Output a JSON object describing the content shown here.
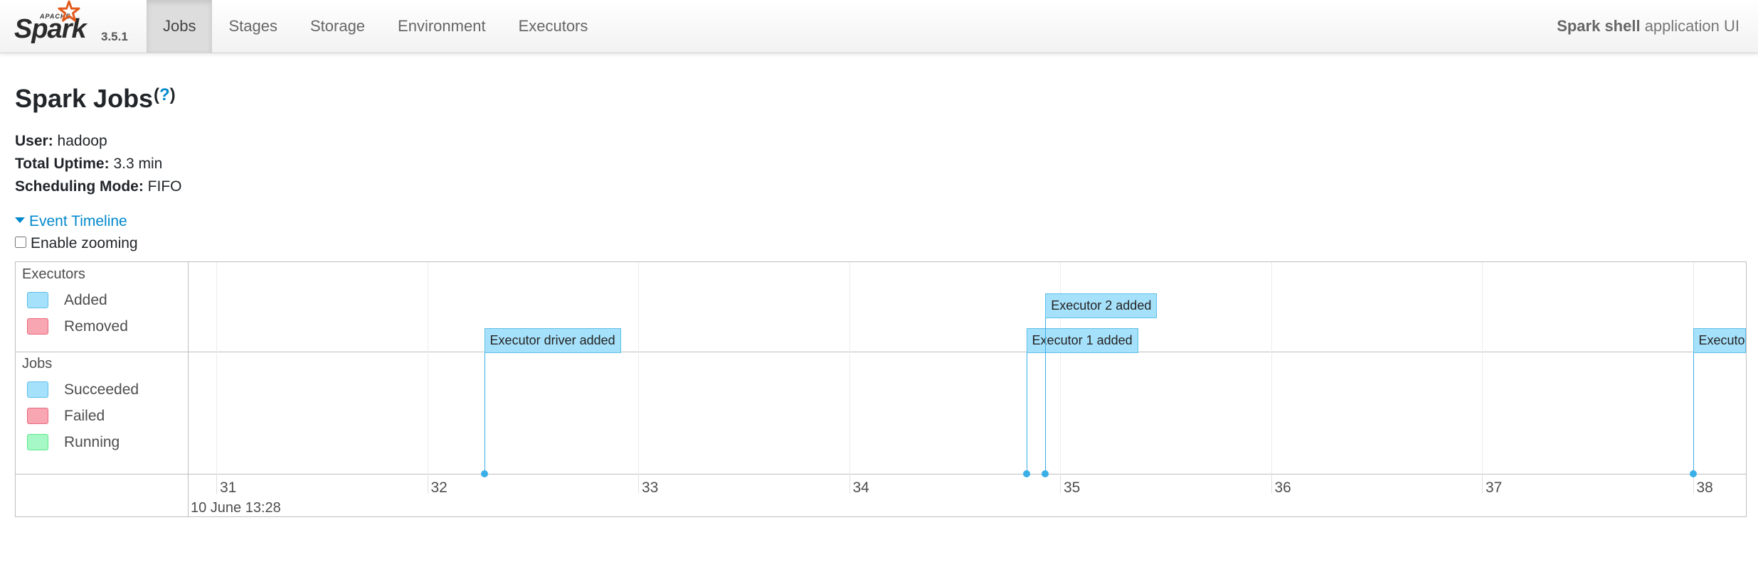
{
  "navbar": {
    "brand_small": "APACHE",
    "brand_name": "Spark",
    "version": "3.5.1",
    "tabs": [
      {
        "label": "Jobs",
        "active": true
      },
      {
        "label": "Stages",
        "active": false
      },
      {
        "label": "Storage",
        "active": false
      },
      {
        "label": "Environment",
        "active": false
      },
      {
        "label": "Executors",
        "active": false
      }
    ],
    "app_name": "Spark shell",
    "app_suffix": " application UI",
    "brand_star_color": "#e25a1c"
  },
  "page": {
    "title": "Spark Jobs",
    "help": "?"
  },
  "summary": {
    "user_label": "User:",
    "user_value": "hadoop",
    "uptime_label": "Total Uptime:",
    "uptime_value": "3.3 min",
    "scheduling_label": "Scheduling Mode:",
    "scheduling_value": "FIFO"
  },
  "timeline": {
    "toggle_label": "Event Timeline",
    "zoom_label": "Enable zooming",
    "zoom_enabled": false,
    "executors_legend": {
      "title": "Executors",
      "items": [
        {
          "label": "Added",
          "fill": "#a6e1fb",
          "stroke": "#5cbfe8"
        },
        {
          "label": "Removed",
          "fill": "#f8a6b1",
          "stroke": "#e8677a"
        }
      ]
    },
    "jobs_legend": {
      "title": "Jobs",
      "items": [
        {
          "label": "Succeeded",
          "fill": "#a6e1fb",
          "stroke": "#5cbfe8"
        },
        {
          "label": "Failed",
          "fill": "#f8a6b1",
          "stroke": "#e8677a"
        },
        {
          "label": "Running",
          "fill": "#a6f8c6",
          "stroke": "#5ce88a"
        }
      ]
    },
    "axis": {
      "ticks": [
        "31",
        "32",
        "33",
        "34",
        "35",
        "36",
        "37",
        "38"
      ],
      "date_label": "10 June 13:28"
    },
    "events": [
      {
        "label": "Executor driver added",
        "time_sec": 32.27
      },
      {
        "label": "Executor 1 added",
        "time_sec": 34.84
      },
      {
        "label": "Executor 2 added",
        "time_sec": 34.93
      },
      {
        "label": "Executor",
        "time_sec": 38.0
      }
    ],
    "accent": "#3aaee6"
  }
}
